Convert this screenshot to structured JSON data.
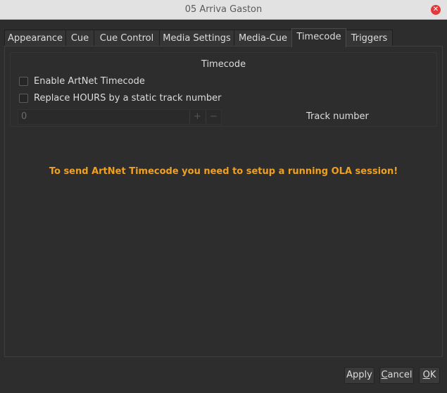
{
  "window": {
    "title": "05 Arriva Gaston"
  },
  "tabs": [
    {
      "label": "Appearance"
    },
    {
      "label": "Cue"
    },
    {
      "label": "Cue Control"
    },
    {
      "label": "Media Settings"
    },
    {
      "label": "Media-Cue"
    },
    {
      "label": "Timecode",
      "active": true
    },
    {
      "label": "Triggers"
    }
  ],
  "timecode": {
    "group_title": "Timecode",
    "enable_label": "Enable ArtNet Timecode",
    "enable_checked": false,
    "replace_label": "Replace HOURS by a static track number",
    "replace_checked": false,
    "track_value": "0",
    "track_plus": "+",
    "track_minus": "−",
    "track_label": "Track number",
    "warning": "To send ArtNet Timecode you need to setup a running OLA session!"
  },
  "buttons": {
    "apply": "Apply",
    "cancel_first": "C",
    "cancel_rest": "ancel",
    "ok_first": "O",
    "ok_rest": "K"
  },
  "colors": {
    "warning": "#f0a020",
    "close": "#e5383b"
  }
}
